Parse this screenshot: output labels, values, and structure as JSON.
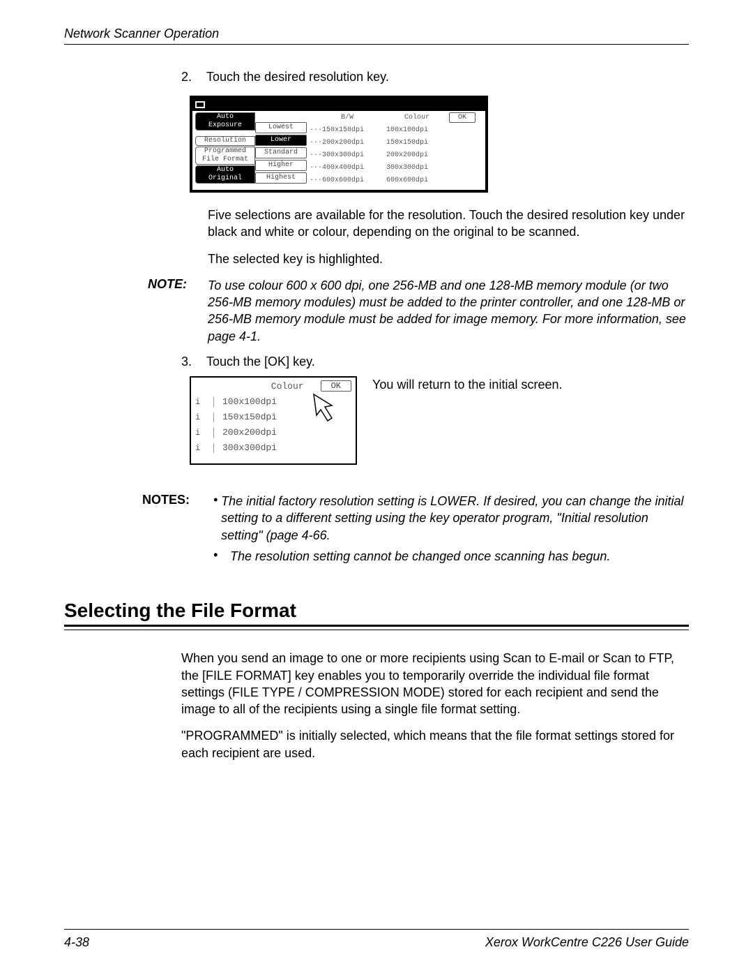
{
  "header": "Network Scanner Operation",
  "step2_num": "2.",
  "step2_text": "Touch the desired resolution key.",
  "screen1": {
    "tabs": {
      "auto": "Auto",
      "exposure": "Exposure",
      "resolution": "Resolution",
      "programmed": "Programmed",
      "file_format": "File Format",
      "auto2": "Auto",
      "original": "Original"
    },
    "buttons": [
      "Lowest",
      "Lower",
      "Standard",
      "Higher",
      "Highest"
    ],
    "bw_header": "B/W",
    "bw": [
      "···150x150dpi",
      "···200x200dpi",
      "···300x300dpi",
      "···400x400dpi",
      "···600x600dpi"
    ],
    "colour_header": "Colour",
    "colour": [
      "100x100dpi",
      "150x150dpi",
      "200x200dpi",
      "300x300dpi",
      "600x600dpi"
    ],
    "ok": "OK"
  },
  "para_five": "Five selections are available for the resolution. Touch the desired resolution key under black and white or colour, depending on the original to be scanned.",
  "para_sel": "The selected key is highlighted.",
  "note_label": "NOTE:",
  "note_body": "To use colour 600 x 600 dpi, one 256-MB and one 128-MB memory module (or two 256-MB memory modules) must be added to the printer controller, and one 128-MB or 256-MB memory module must be added for image memory. For more information, see page 4-1.",
  "step3_num": "3.",
  "step3_text": "Touch the [OK] key.",
  "screen2": {
    "colour": "Colour",
    "ok": "OK",
    "rows": [
      "100x100dpi",
      "150x150dpi",
      "200x200dpi",
      "300x300dpi"
    ],
    "i": "i"
  },
  "side_text": "You will return to the initial screen.",
  "notes_label": "NOTES:",
  "notes": [
    "The initial factory resolution setting is LOWER. If desired, you can change the initial setting to a different setting using the key operator program, \"Initial resolution setting\" (page 4-66.",
    "The resolution setting cannot be changed once scanning has begun."
  ],
  "section_title": "Selecting the File Format",
  "body1": "When you send an image to one or more recipients using Scan to E-mail or Scan to FTP, the [FILE FORMAT] key enables you to temporarily override the individual file format settings (FILE TYPE / COMPRESSION MODE) stored for each recipient and send the image to all of the recipients using a single file format setting.",
  "body2": "\"PROGRAMMED\" is initially selected, which means that the file format settings stored for each recipient are used.",
  "footer_left": "4-38",
  "footer_right": "Xerox WorkCentre C226 User Guide"
}
